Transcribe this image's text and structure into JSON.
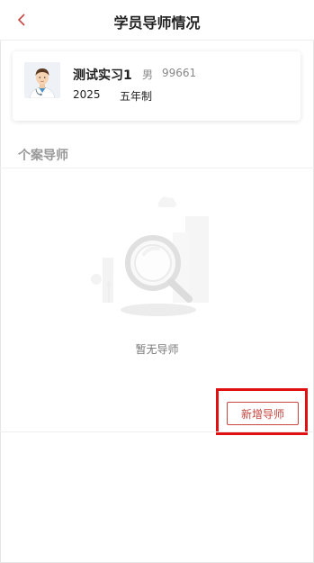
{
  "header": {
    "title": "学员导师情况",
    "back_icon": "chevron-left-icon"
  },
  "student": {
    "name": "测试实习1",
    "gender": "男",
    "id": "99661",
    "year": "2025",
    "program": "五年制",
    "avatar_icon": "doctor-avatar-icon"
  },
  "section": {
    "title": "个案导师"
  },
  "empty_state": {
    "text": "暂无导师",
    "icon": "empty-search-icon"
  },
  "actions": {
    "add_label": "新增导师"
  },
  "colors": {
    "accent": "#c9453f",
    "highlight": "#e01010"
  }
}
